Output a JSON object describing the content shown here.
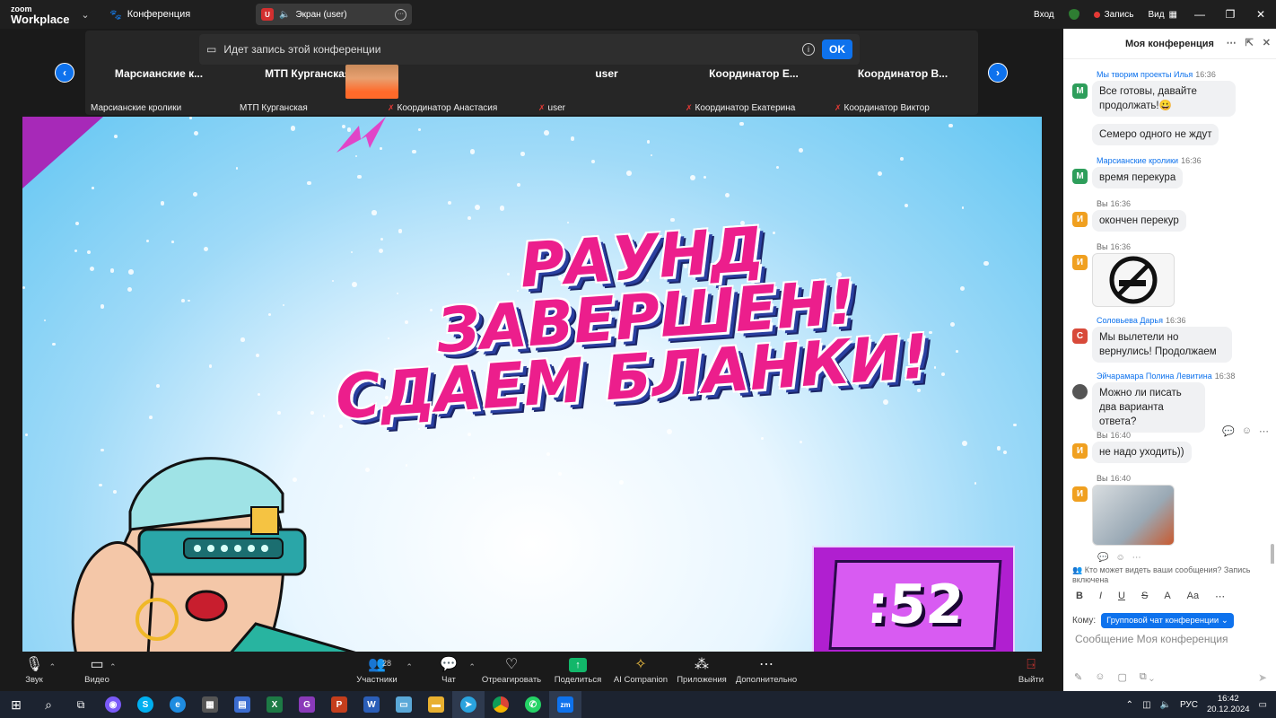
{
  "topbar": {
    "logo_line1": "zoom",
    "logo_line2": "Workplace",
    "conference_label": "Конференция",
    "screen_pill": "Экран (user)",
    "screen_badge": "U",
    "login": "Вход",
    "record": "Запись",
    "view": "Вид"
  },
  "recording_banner": {
    "text": "Идет запись этой конференции",
    "ok": "OK"
  },
  "participants": [
    {
      "name": "Марсианские к...",
      "sub": "Марсианские кролики",
      "muted": false
    },
    {
      "name": "МТП Курганская",
      "sub": "МТП Курганская",
      "muted": false
    },
    {
      "name": "",
      "sub": "Координатор Анастасия",
      "muted": true
    },
    {
      "name": "user",
      "sub": "user",
      "muted": true
    },
    {
      "name": "Координатор Е...",
      "sub": "Координатор Екатерина",
      "muted": true
    },
    {
      "name": "Координатор В...",
      "sub": "Координатор Виктор",
      "muted": true
    }
  ],
  "slide": {
    "title_line1": "РАУНД ЗАВЕРШЕН!",
    "title_line2": "СДАЕМ БЛАНКИ!",
    "timer": ":52"
  },
  "toolbar": {
    "audio": "Звук",
    "video": "Видео",
    "participants": "Участники",
    "participants_count": "28",
    "chat": "Чат",
    "react": "Отреагировать",
    "share": "Поделиться",
    "ai": "AI Companion",
    "apps": "Приложения",
    "more": "Дополнительно",
    "leave": "Выйти"
  },
  "chat": {
    "title": "Моя конференция",
    "messages": [
      {
        "sender": "Мы творим проекты Илья",
        "time": "16:36",
        "avatar": "М",
        "color": "#2e9e5b",
        "text": "Все готовы, давайте продолжать!😀"
      },
      {
        "sender": "",
        "time": "",
        "avatar": "",
        "color": "",
        "text": "Семеро одного не ждут"
      },
      {
        "sender": "Марсианские кролики",
        "time": "16:36",
        "avatar": "М",
        "color": "#2e9e5b",
        "text": "время перекура"
      },
      {
        "sender": "Вы",
        "time": "16:36",
        "avatar": "И",
        "color": "#f0a020",
        "text": "окончен перекур"
      },
      {
        "sender": "Вы",
        "time": "16:36",
        "avatar": "И",
        "color": "#f0a020",
        "text": "[no-smoking sticker]"
      },
      {
        "sender": "Соловьева Дарья",
        "time": "16:36",
        "avatar": "С",
        "color": "#d84a3a",
        "text": "Мы вылетели но вернулись! Продолжаем"
      },
      {
        "sender": "Эйчарамара Полина Левитина",
        "time": "16:38",
        "avatar": "",
        "color": "#555",
        "text": "Можно ли писать два варианта ответа?"
      },
      {
        "sender": "Вы",
        "time": "16:40",
        "avatar": "И",
        "color": "#f0a020",
        "text": "не надо уходить))"
      },
      {
        "sender": "Вы",
        "time": "16:40",
        "avatar": "И",
        "color": "#f0a020",
        "text": "[cartoon sticker]"
      }
    ],
    "privacy": "Кто может видеть ваши сообщения? Запись включена",
    "to_label": "Кому:",
    "to_value": "Групповой чат конференции",
    "placeholder": "Сообщение Моя конференция"
  },
  "taskbar": {
    "lang": "РУС",
    "time": "16:42",
    "date": "20.12.2024",
    "badge_telegram": "19",
    "badge_chrome": "27"
  }
}
